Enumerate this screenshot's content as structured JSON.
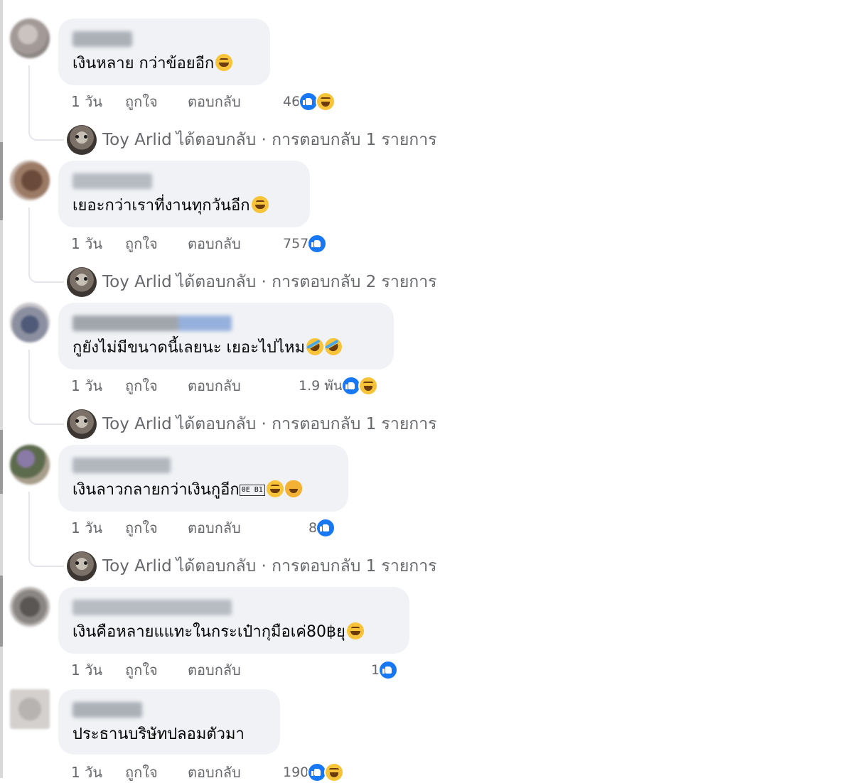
{
  "comments": [
    {
      "text": "เงินหลาย กว่าข้อยอีก",
      "emoji": [
        "grinning-squint-icon"
      ],
      "time": "1 วัน",
      "like_label": "ถูกใจ",
      "reply_label": "ตอบกลับ",
      "reaction_count": "46",
      "reactions": [
        "like",
        "haha"
      ],
      "replies": {
        "name": "Toy Arlid",
        "text": "ได้ตอบกลับ · การตอบกลับ 1 รายการ"
      }
    },
    {
      "text": "เยอะกว่าเราที่งานทุกวันอีก",
      "emoji": [
        "grinning-icon"
      ],
      "time": "1 วัน",
      "like_label": "ถูกใจ",
      "reply_label": "ตอบกลับ",
      "reaction_count": "757",
      "reactions": [
        "like"
      ],
      "replies": {
        "name": "Toy Arlid",
        "text": "ได้ตอบกลับ · การตอบกลับ 2 รายการ"
      }
    },
    {
      "text": "กูยังไม่มีขนาดนี้เลยนะ เยอะไปไหม",
      "emoji": [
        "rofl-icon",
        "rofl-icon"
      ],
      "time": "1 วัน",
      "like_label": "ถูกใจ",
      "reply_label": "ตอบกลับ",
      "reaction_count": "1.9 พัน",
      "reactions": [
        "like",
        "haha"
      ],
      "replies": {
        "name": "Toy Arlid",
        "text": "ได้ตอบกลับ · การตอบกลับ 1 รายการ"
      }
    },
    {
      "text": "เงินลาวกลายกว่าเงินกูอีก",
      "glyph": "0E\nB1",
      "emoji": [
        "grinning-icon",
        "cat-laugh-icon"
      ],
      "time": "1 วัน",
      "like_label": "ถูกใจ",
      "reply_label": "ตอบกลับ",
      "reaction_count": "8",
      "reactions": [
        "like"
      ],
      "replies": {
        "name": "Toy Arlid",
        "text": "ได้ตอบกลับ · การตอบกลับ 1 รายการ"
      }
    },
    {
      "text": "เงินคือหลายแแทะในกระเป๋ากุมือเค่80฿ยุ",
      "emoji": [
        "grin-icon"
      ],
      "time": "1 วัน",
      "like_label": "ถูกใจ",
      "reply_label": "ตอบกลับ",
      "reaction_count": "1",
      "reactions": [
        "like"
      ]
    },
    {
      "text": "ประธานบริษัทปลอมตัวมา",
      "emoji": [],
      "time": "1 วัน",
      "like_label": "ถูกใจ",
      "reply_label": "ตอบกลับ",
      "reaction_count": "190",
      "reactions": [
        "like",
        "haha"
      ]
    }
  ]
}
